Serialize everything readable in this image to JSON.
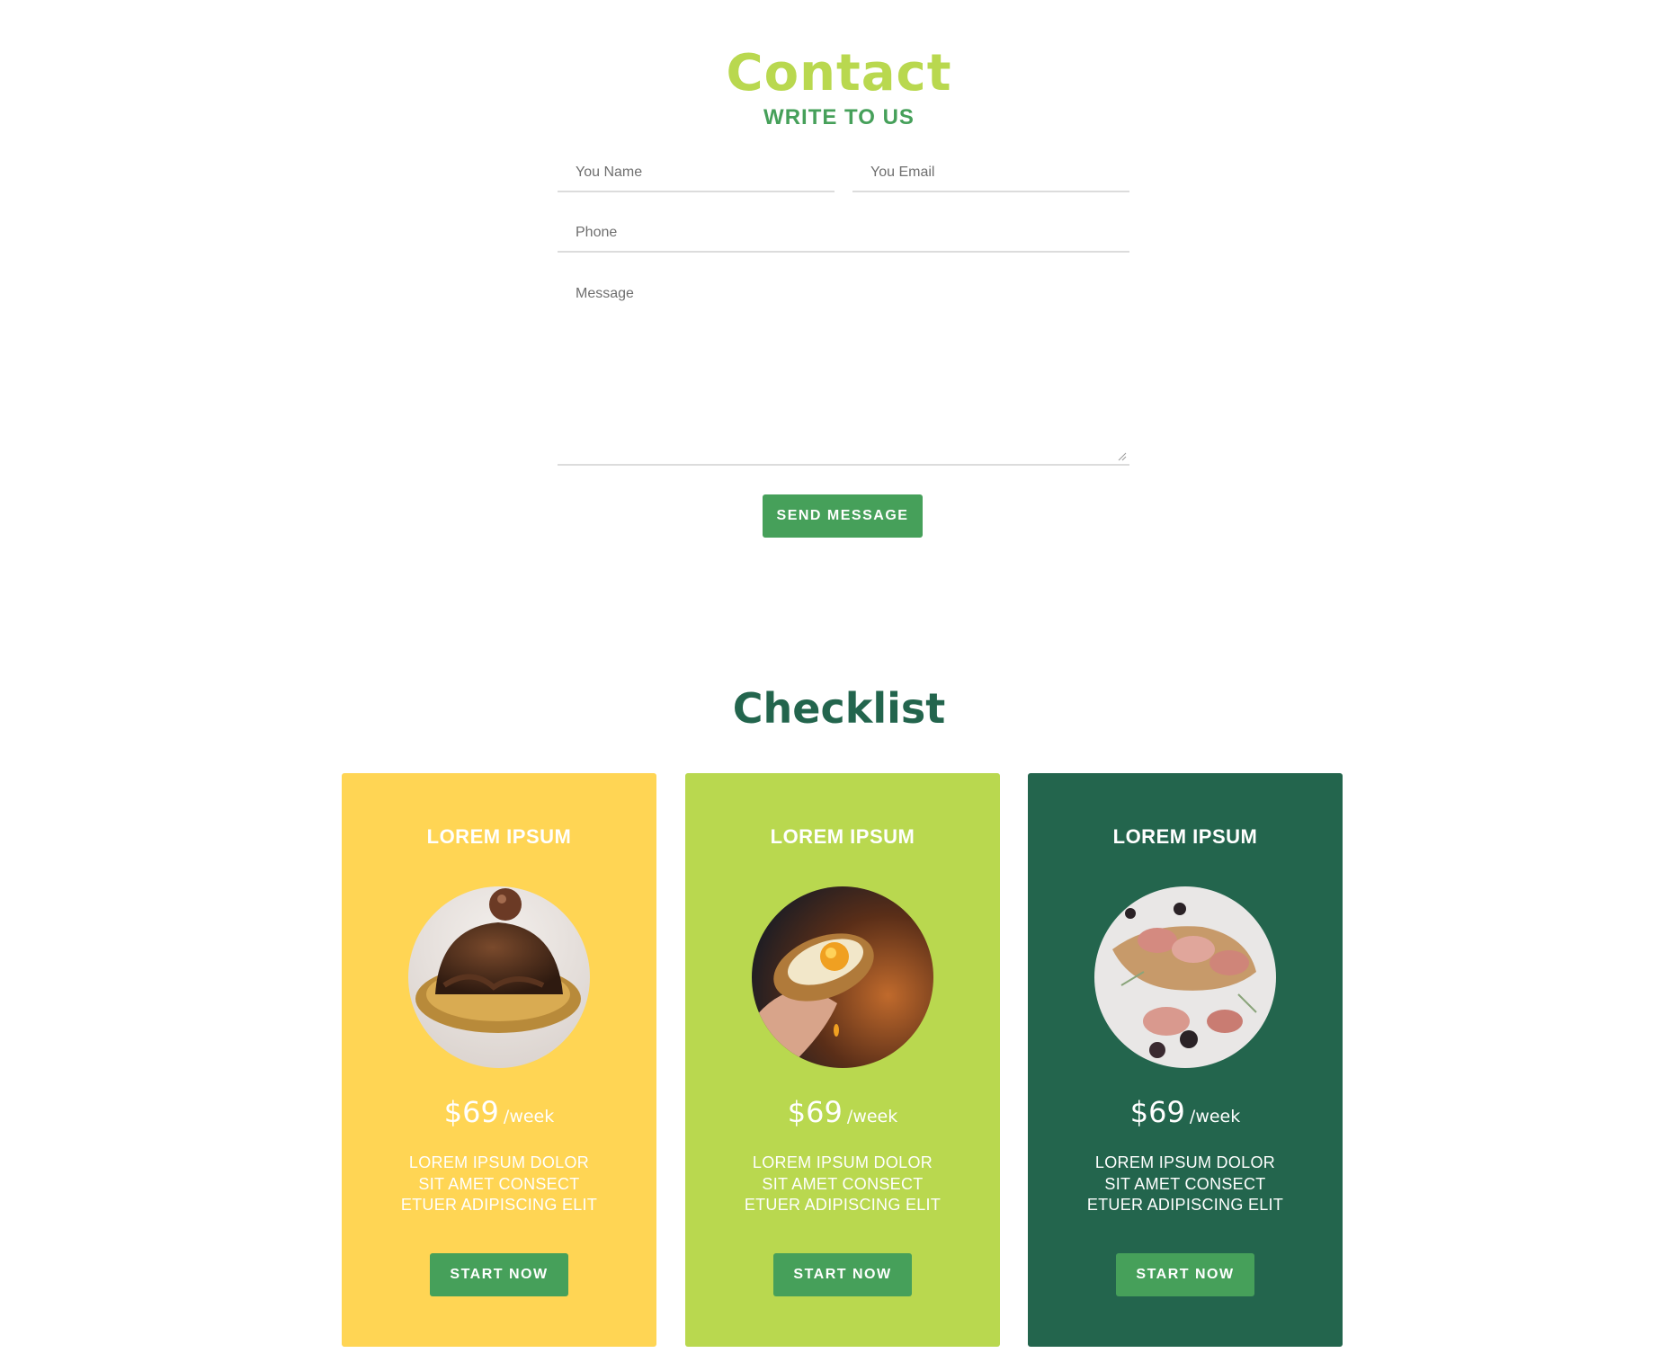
{
  "contact": {
    "title": "Contact",
    "subtitle": "WRITE TO US",
    "name_placeholder": "You Name",
    "email_placeholder": "You Email",
    "phone_placeholder": "Phone",
    "message_placeholder": "Message",
    "send_label": "SEND MESSAGE"
  },
  "checklist": {
    "title": "Checklist",
    "cards": [
      {
        "title": "LOREM IPSUM",
        "image": "chocolate-dessert-image",
        "price": "$69",
        "period": "/week",
        "desc_lines": [
          "LOREM IPSUM DOLOR",
          "SIT AMET CONSECT",
          "ETUER ADIPISCING ELIT"
        ],
        "button": "START NOW",
        "color": "#ffd554"
      },
      {
        "title": "LOREM IPSUM",
        "image": "egg-sandwich-image",
        "price": "$69",
        "period": "/week",
        "desc_lines": [
          "LOREM IPSUM DOLOR",
          "SIT AMET CONSECT",
          "ETUER ADIPISCING ELIT"
        ],
        "button": "START NOW",
        "color": "#b9d84f"
      },
      {
        "title": "LOREM IPSUM",
        "image": "bacon-rolls-image",
        "price": "$69",
        "period": "/week",
        "desc_lines": [
          "LOREM IPSUM DOLOR",
          "SIT AMET CONSECT",
          "ETUER ADIPISCING ELIT"
        ],
        "button": "START NOW",
        "color": "#23654d"
      }
    ]
  },
  "colors": {
    "accent_lime": "#b9d84f",
    "accent_green": "#46a05a",
    "dark_green": "#23654d",
    "yellow": "#ffd554"
  }
}
